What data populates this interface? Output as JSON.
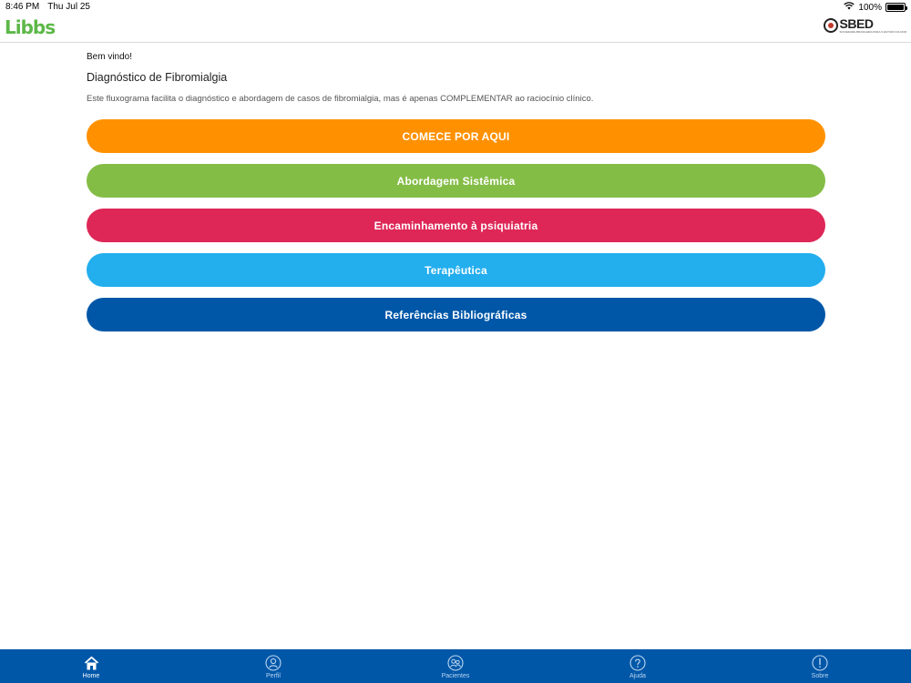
{
  "status_bar": {
    "time": "8:46 PM",
    "date": "Thu Jul 25",
    "battery": "100%",
    "battery_level": 1.0
  },
  "header": {
    "brand": "Libbs",
    "partner": "SBED",
    "partner_subtitle": "SOCIEDADE BRASILEIRA PARA O ESTUDO DA DOR"
  },
  "main": {
    "greeting": "Bem vindo!",
    "title": "Diagnóstico de Fibromialgia",
    "description": "Este fluxograma facilita o diagnóstico e abordagem de casos de fibromialgia, mas é apenas COMPLEMENTAR ao raciocínio clínico.",
    "buttons": [
      {
        "label": "COMECE POR AQUI",
        "color": "#ff9100"
      },
      {
        "label": "Abordagem Sistêmica",
        "color": "#84bd46"
      },
      {
        "label": "Encaminhamento à psiquiatria",
        "color": "#de2757"
      },
      {
        "label": "Terapêutica",
        "color": "#23aeee"
      },
      {
        "label": "Referências Bibliográficas",
        "color": "#0057a8"
      }
    ]
  },
  "tab_bar": {
    "color": "#0057a8",
    "tabs": [
      {
        "label": "Home",
        "icon": "home-icon",
        "active": true
      },
      {
        "label": "Perfil",
        "icon": "profile-icon",
        "active": false
      },
      {
        "label": "Pacientes",
        "icon": "patients-icon",
        "active": false
      },
      {
        "label": "Ajuda",
        "icon": "help-icon",
        "active": false
      },
      {
        "label": "Sobre",
        "icon": "info-icon",
        "active": false
      }
    ]
  }
}
